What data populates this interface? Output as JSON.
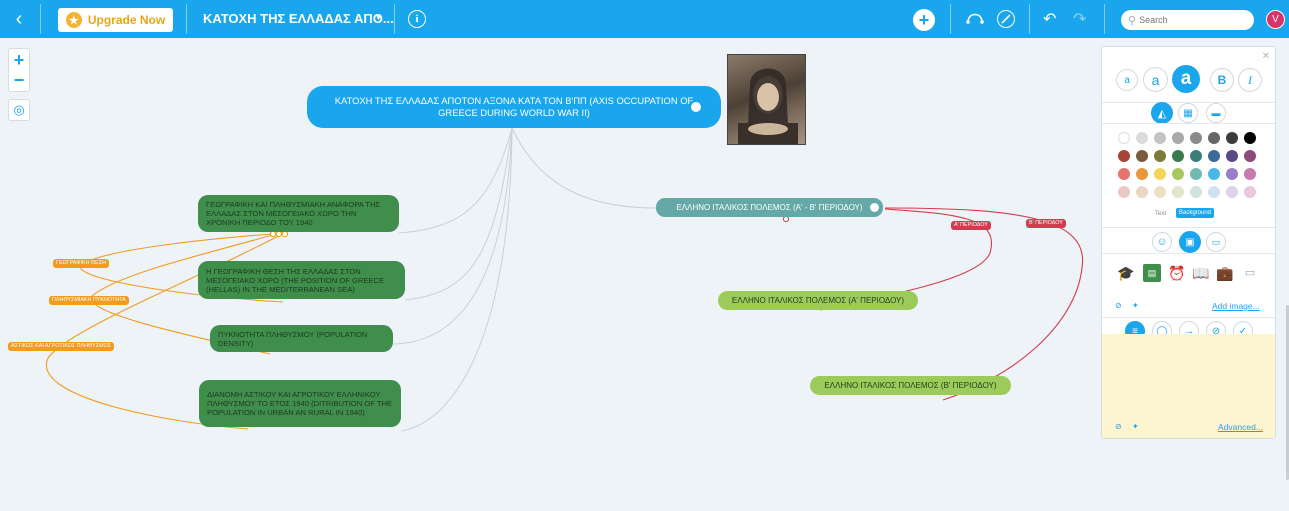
{
  "toolbar": {
    "back_icon": "chevron-left-icon",
    "upgrade_label": "Upgrade Now",
    "upgrade_star": "★",
    "map_title": "ΚΑΤΟΧΗ ΤΗΣ ΕΛΛΑΔΑΣ ΑΠΟ...",
    "info_glyph": "i",
    "add_glyph": "+",
    "search_placeholder": "Search",
    "avatar_letter": "V"
  },
  "canvas": {
    "central_topic": "ΚΑΤΟΧΗ ΤΗΣ ΕΛΛΑΔΑΣ ΑΠΟΤΟΝ ΑΞΟΝΑ ΚΑΤΑ ΤΟΝ Β'ΠΠ (AXIS OCCUPATION OF GREECE DURING WORLD WAR II)",
    "nodes": {
      "geo": "ΓΕΩΓΡΑΦΙΚΗ ΚΑΙ ΠΛΗΘΥΣΜΙΑΚΗ ΑΝΑΦΟΡΑ ΤΗΣ ΕΛΛΑΔΑΣ ΣΤΟΝ ΜΕΣΟΓΕΙΑΚΟ ΧΩΡΟ ΤΗΝ ΧΡΟΝΙΚΗ ΠΕΡΙΟΔΟ ΤΟΥ 1940",
      "position": "Η ΓΕΩΓΡΑΦΙΚΗ ΘΕΣΗ ΤΗΣ ΕΛΛΑΔΑΣ ΣΤΟΝ ΜΕΣΟΓΕΙΑΚΟ ΧΩΡΟ (THE POSITION OF GREECE (HELLAS) IN THE MEDITERRANEAN SEA)",
      "density": "ΠΥΚΝΟΤΗΤΑ ΠΛΗΘΥΣΜΟΥ (POPULATION DENSITY)",
      "distribution": "ΔΙΑΝΟΜΗ ΑΣΤΙΚΟΥ ΚΑΙ ΑΓΡΟΤΙΚΟΥ ΕΛΛΗΝΙΚΟΥ ΠΛΗΘΥΣΜΟΥ ΤΟ ΕΤΟΣ 1940 (DITRIBUTION OF THE POPULATION IN URBAN AN RURAL IN 1940)",
      "war": "ΕΛΛΗΝΟ ΙΤΑΛΙΚΟΣ ΠΟΛΕΜΟΣ (Α' - Β' ΠΕΡΙΟΔΟΥ)",
      "war_a": "ΕΛΛΗΝΟ ΙΤΑΛΙΚΟΣ ΠΟΛΕΜΟΣ (Α' ΠΕΡΙΟΔΟΥ)",
      "war_b": "ΕΛΛΗΝΟ ΙΤΑΛΙΚΟΣ ΠΟΛΕΜΟΣ (Β' ΠΕΡΙΟΔΟΥ)"
    },
    "tags": {
      "geo_position": "ΓΕΩΓΡΑΦΙΚΗ ΘΕΣΗ",
      "pop_density": "ΠΛΗΘΥΣΜΙΑΚΗ ΠΥΚΝΟΤΗΤΑ",
      "urban_rural": "ΑΣΤΙΚΟΣ ΚΑΙ ΑΓΡΟΤΙΚΟΣ ΠΛΗΘΥΣΜΟΣ",
      "period_a": "Α' ΠΕΡΙΟΔΟΥ",
      "period_b": "Β' ΠΕΡΙΟΔΟΥ"
    },
    "colors": {
      "central": "#1aa6ec",
      "green_node": "#3f8e4c",
      "teal_node": "#64a9a7",
      "lime_node": "#9dcb59",
      "orange_link": "#f29c1f",
      "red_link": "#d33c4f"
    }
  },
  "panel": {
    "font_sizes": [
      "a",
      "a",
      "a"
    ],
    "bold": "B",
    "italic": "I",
    "text_label": "Text",
    "background_label": "Background",
    "add_image_label": "Add image...",
    "advanced_label": "Advanced...",
    "swatches": [
      [
        "#ffffff",
        "#dcdcdc",
        "#c4c4c4",
        "#a9a9a9",
        "#8b8b8b",
        "#666666",
        "#3c3c3c",
        "#000000"
      ],
      [
        "#a8433a",
        "#7a5b3d",
        "#7f7a3a",
        "#3b7b4b",
        "#3f7d7d",
        "#3c6a9a",
        "#5a4a8a",
        "#8a4a7a"
      ],
      [
        "#e3736c",
        "#e9963f",
        "#f2d45a",
        "#a5c95e",
        "#74b9b0",
        "#4bb7e6",
        "#9a7fc8",
        "#c77aaf"
      ],
      [
        "#e8c9c5",
        "#ead7c4",
        "#ece1c3",
        "#dfe6cb",
        "#cfe4df",
        "#cfe3ef",
        "#dcd2ea",
        "#eac9dc"
      ]
    ],
    "image_icons": [
      "graduation-cap-icon",
      "chalkboard-icon",
      "alarm-clock-icon",
      "book-icon",
      "briefcase-icon",
      "id-card-icon"
    ]
  }
}
